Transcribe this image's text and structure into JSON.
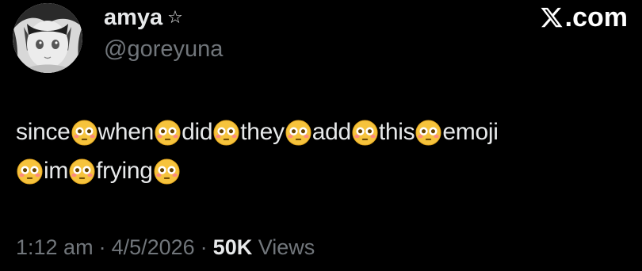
{
  "author": {
    "display_name": "amya",
    "badge_glyph": "☆",
    "handle": "@goreyuna",
    "avatar_icon": "anime-girl-avatar"
  },
  "brand": {
    "logo_icon": "x-logo-icon",
    "suffix": ".com"
  },
  "tweet": {
    "line1": [
      {
        "type": "text",
        "value": "since"
      },
      {
        "type": "emoji",
        "name": "flushed-face-emoji"
      },
      {
        "type": "text",
        "value": "when"
      },
      {
        "type": "emoji",
        "name": "flushed-face-emoji"
      },
      {
        "type": "text",
        "value": "did"
      },
      {
        "type": "emoji",
        "name": "flushed-face-emoji"
      },
      {
        "type": "text",
        "value": "they"
      },
      {
        "type": "emoji",
        "name": "flushed-face-emoji"
      },
      {
        "type": "text",
        "value": "add"
      },
      {
        "type": "emoji",
        "name": "flushed-face-emoji"
      },
      {
        "type": "text",
        "value": "this"
      },
      {
        "type": "emoji",
        "name": "flushed-face-emoji"
      },
      {
        "type": "text",
        "value": "emoji"
      }
    ],
    "line2": [
      {
        "type": "emoji",
        "name": "flushed-face-emoji"
      },
      {
        "type": "text",
        "value": "im"
      },
      {
        "type": "emoji",
        "name": "flushed-face-emoji"
      },
      {
        "type": "text",
        "value": "frying"
      },
      {
        "type": "emoji",
        "name": "flushed-face-emoji"
      }
    ]
  },
  "meta": {
    "time": "1:12 am",
    "separator": "·",
    "date": "4/5/2026",
    "views_count": "50K",
    "views_label": "Views"
  },
  "colors": {
    "background": "#000000",
    "primary_text": "#e7e9ea",
    "secondary_text": "#71767b",
    "emoji_face": "#f6c33c"
  }
}
